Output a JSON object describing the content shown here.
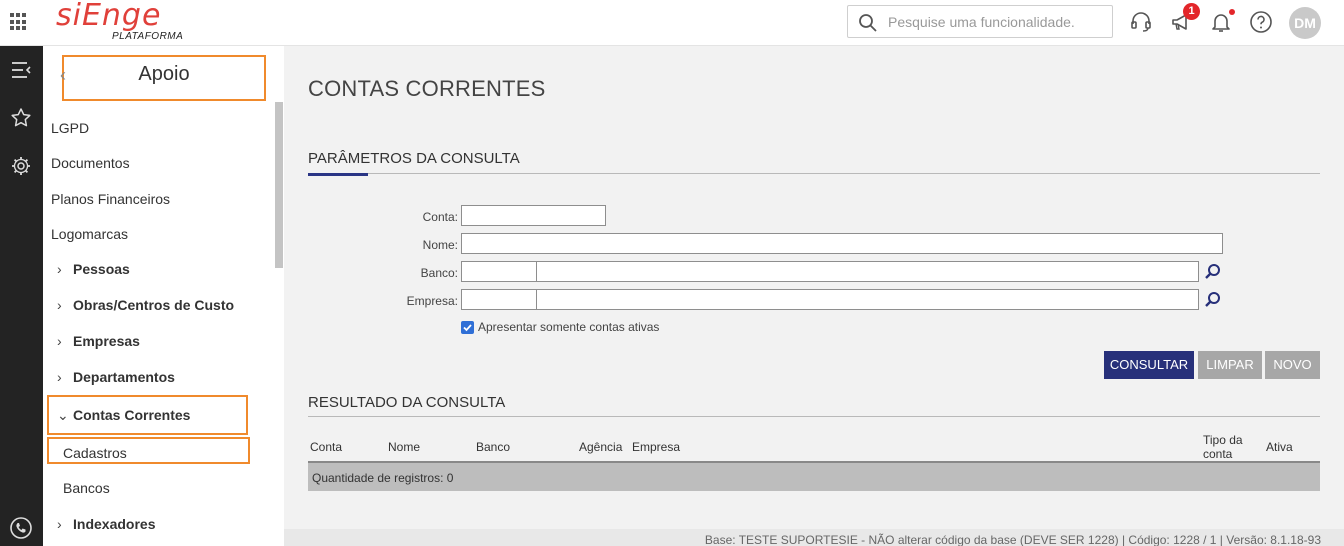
{
  "header": {
    "logo_text": "siEnge",
    "logo_sub": "PLATAFORMA",
    "search_placeholder": "Pesquise uma funcionalidade.",
    "notifications_count": "1",
    "avatar_initials": "DM",
    "accent_color": "#e0403a"
  },
  "sidebar": {
    "title": "Apoio",
    "back_icon": "chevron-left-icon",
    "items": [
      "LGPD",
      "Documentos",
      "Planos Financeiros",
      "Logomarcas"
    ],
    "groups": [
      "Pessoas",
      "Obras/Centros de Custo",
      "Empresas",
      "Departamentos"
    ],
    "open_group": "Contas Correntes",
    "open_group_children": [
      "Cadastros",
      "Bancos"
    ],
    "last_group": "Indexadores"
  },
  "main": {
    "page_title": "CONTAS CORRENTES",
    "params_title": "PARÂMETROS DA CONSULTA",
    "fields": {
      "conta_label": "Conta:",
      "nome_label": "Nome:",
      "banco_label": "Banco:",
      "empresa_label": "Empresa:",
      "conta_value": "",
      "nome_value": "",
      "banco_code": "",
      "banco_name": "",
      "empresa_code": "",
      "empresa_name": ""
    },
    "checkbox_label": "Apresentar somente contas ativas",
    "checkbox_checked": true,
    "buttons": {
      "consultar": "CONSULTAR",
      "limpar": "LIMPAR",
      "novo": "NOVO"
    },
    "results_title": "RESULTADO DA CONSULTA",
    "columns": {
      "conta": "Conta",
      "nome": "Nome",
      "banco": "Banco",
      "agencia": "Agência",
      "empresa": "Empresa",
      "tipo_1": "Tipo da",
      "tipo_2": "conta",
      "ativa": "Ativa"
    },
    "record_count": "Quantidade de registros: 0",
    "footer": "Base: TESTE SUPORTESIE - NÃO alterar código da base (DEVE SER 1228) | Código: 1228 / 1 | Versão: 8.1.18-93"
  }
}
